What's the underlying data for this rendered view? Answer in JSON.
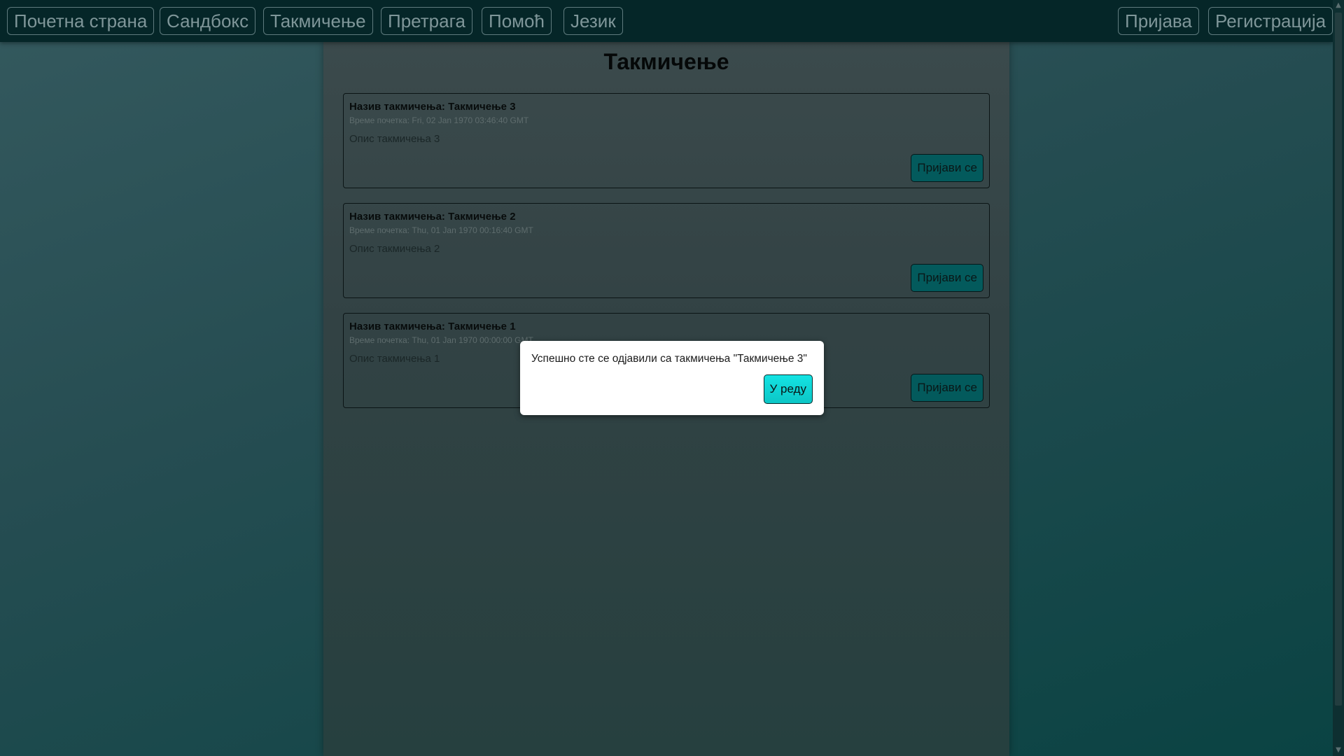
{
  "nav": {
    "home": "Почетна страна",
    "sandbox": "Сандбокс",
    "competition": "Такмичење",
    "search": "Претрага",
    "help": "Помоћ",
    "language": "Језик",
    "login": "Пријава",
    "register": "Регистрација"
  },
  "page": {
    "title": "Такмичење"
  },
  "competitions": [
    {
      "title": "Назив такмичења: Такмичење 3",
      "start_time": "Време почетка: Fri, 02 Jan 1970 03:46:40 GMT",
      "description": "Опис такмичења 3",
      "button": "Пријави се"
    },
    {
      "title": "Назив такмичења: Такмичење 2",
      "start_time": "Време почетка: Thu, 01 Jan 1970 00:16:40 GMT",
      "description": "Опис такмичења 2",
      "button": "Пријави се"
    },
    {
      "title": "Назив такмичења: Такмичење 1",
      "start_time": "Време почетка: Thu, 01 Jan 1970 00:00:00 GMT",
      "description": "Опис такмичења 1",
      "button": "Пријави се"
    }
  ],
  "modal": {
    "message": "Успешно сте се одјавили са такмичења \"Такмичење 3\"",
    "ok_button": "У реду"
  },
  "colors": {
    "navbar": "#052628",
    "card_button": "#035a5c",
    "modal_button": "#14e3e3"
  }
}
